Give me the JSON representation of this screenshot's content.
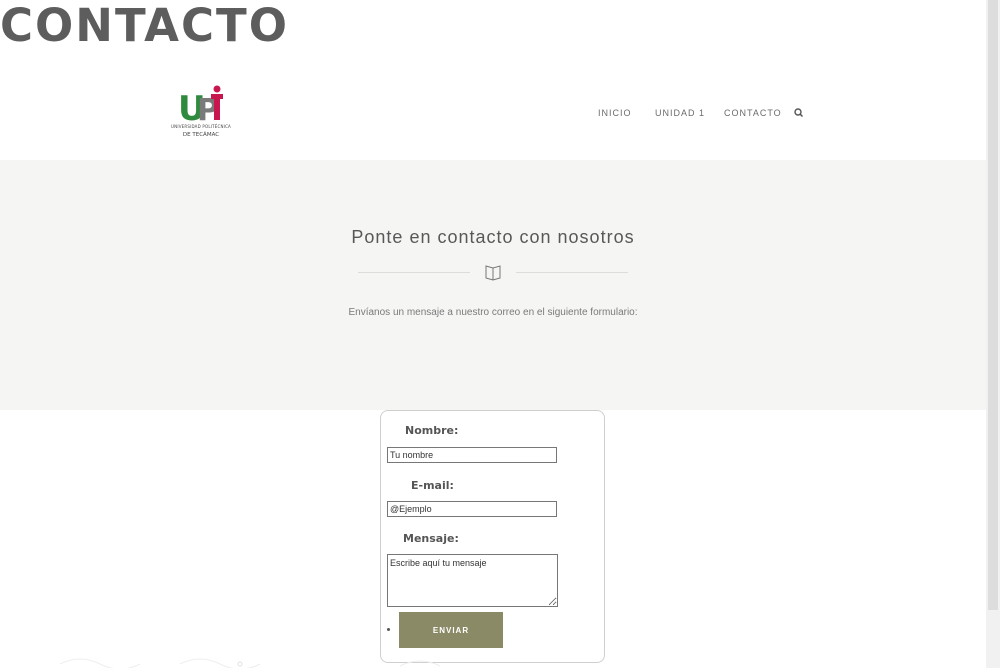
{
  "page": {
    "heading": "CONTACTO"
  },
  "brand": {
    "logo_text": "UPT",
    "sub_line1": "UNIVERSIDAD POLITÉCNICA",
    "sub_line2": "DE TECÁMAC",
    "colors": {
      "green": "#2e8b3d",
      "magenta": "#c8174f",
      "gray": "#7a7a7a"
    }
  },
  "nav": {
    "items": [
      {
        "label": "INICIO"
      },
      {
        "label": "UNIDAD 1"
      },
      {
        "label": "CONTACTO"
      }
    ],
    "search_icon": "search-icon"
  },
  "hero": {
    "title": "Ponte en contacto con nosotros",
    "icon": "book-icon",
    "text": "Envíanos un mensaje a nuestro correo en el siguiente formulario:"
  },
  "form": {
    "name_label": "Nombre:",
    "name_placeholder": "Tu nombre",
    "email_label": "E-mail:",
    "email_placeholder": "@Ejemplo",
    "message_label": "Mensaje:",
    "message_placeholder": "Escribe aquí tu mensaje",
    "submit_label": "ENVIAR"
  },
  "colors": {
    "button": "#8a8a66",
    "hero_bg": "#f5f5f4",
    "heading": "#5d5d5d"
  }
}
